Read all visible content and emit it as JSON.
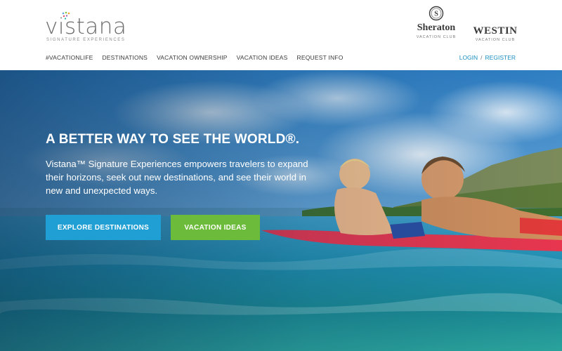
{
  "logo": {
    "wordmark": "vistana",
    "tagline": "SIGNATURE EXPERIENCES"
  },
  "brands": {
    "sheraton": {
      "name": "Sheraton",
      "sub": "VACATION CLUB"
    },
    "westin": {
      "name": "WESTIN",
      "sub": "VACATION CLUB"
    }
  },
  "nav": {
    "items": [
      {
        "label": "#VACATIONLIFE"
      },
      {
        "label": "DESTINATIONS"
      },
      {
        "label": "VACATION OWNERSHIP"
      },
      {
        "label": "VACATION IDEAS"
      },
      {
        "label": "REQUEST INFO"
      }
    ],
    "login": "LOGIN",
    "separator": "/",
    "register": "REGISTER"
  },
  "hero": {
    "title": "A BETTER WAY TO SEE THE WORLD®.",
    "text": "Vistana™ Signature Experiences empowers travelers to expand their horizons, seek out new destinations, and see their world in new and unexpected ways.",
    "buttons": {
      "explore": "EXPLORE DESTINATIONS",
      "ideas": "VACATION IDEAS"
    }
  },
  "colors": {
    "accent_blue": "#1f9fd3",
    "accent_green": "#6dbb3b",
    "link_blue": "#1a8fbf"
  }
}
